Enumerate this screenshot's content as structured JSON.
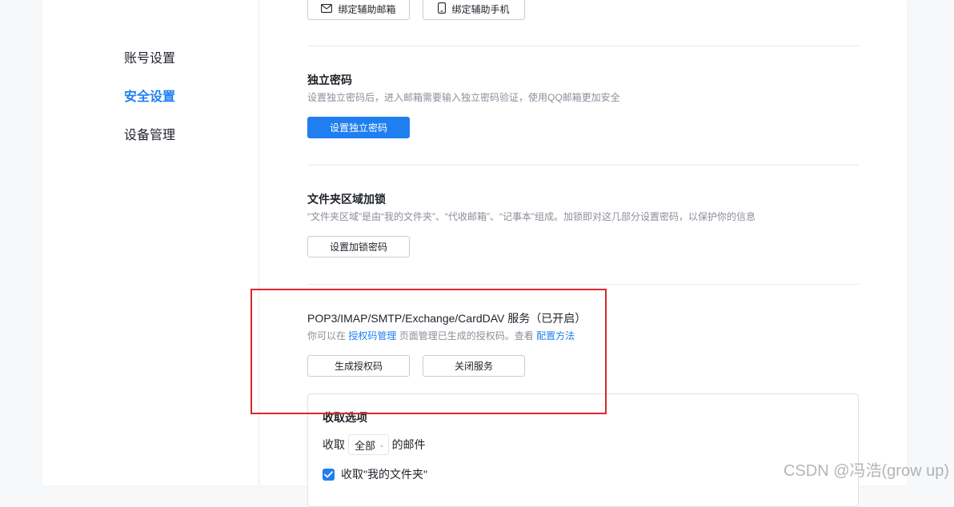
{
  "sidebar": {
    "items": [
      {
        "label": "账号设置",
        "active": false
      },
      {
        "label": "安全设置",
        "active": true
      },
      {
        "label": "设备管理",
        "active": false
      }
    ]
  },
  "top_buttons": {
    "bind_email": "绑定辅助邮箱",
    "bind_phone": "绑定辅助手机"
  },
  "independent_password": {
    "title": "独立密码",
    "desc": "设置独立密码后，进入邮箱需要输入独立密码验证，使用QQ邮箱更加安全",
    "button": "设置独立密码"
  },
  "folder_lock": {
    "title": "文件夹区域加锁",
    "desc": "“文件夹区域”是由“我的文件夹”、“代收邮箱”、“记事本”组成。加锁即对这几部分设置密码，以保护你的信息",
    "button": "设置加锁密码"
  },
  "pop3_service": {
    "title": "POP3/IMAP/SMTP/Exchange/CardDAV 服务（已开启）",
    "desc_prefix": "你可以在",
    "desc_link1": "授权码管理",
    "desc_middle": "页面管理已生成的授权码。查看",
    "desc_link2": "配置方法",
    "generate_button": "生成授权码",
    "close_button": "关闭服务"
  },
  "receive_options": {
    "title": "收取选项",
    "receive_prefix": "收取",
    "receive_select": "全部",
    "receive_suffix": "的邮件",
    "checkbox_label": "收取\"我的文件夹\"",
    "checkbox_checked": true
  },
  "watermark": "CSDN @冯浩(grow up)",
  "colors": {
    "accent": "#1f7ff0",
    "highlight_box": "#d9272e"
  }
}
